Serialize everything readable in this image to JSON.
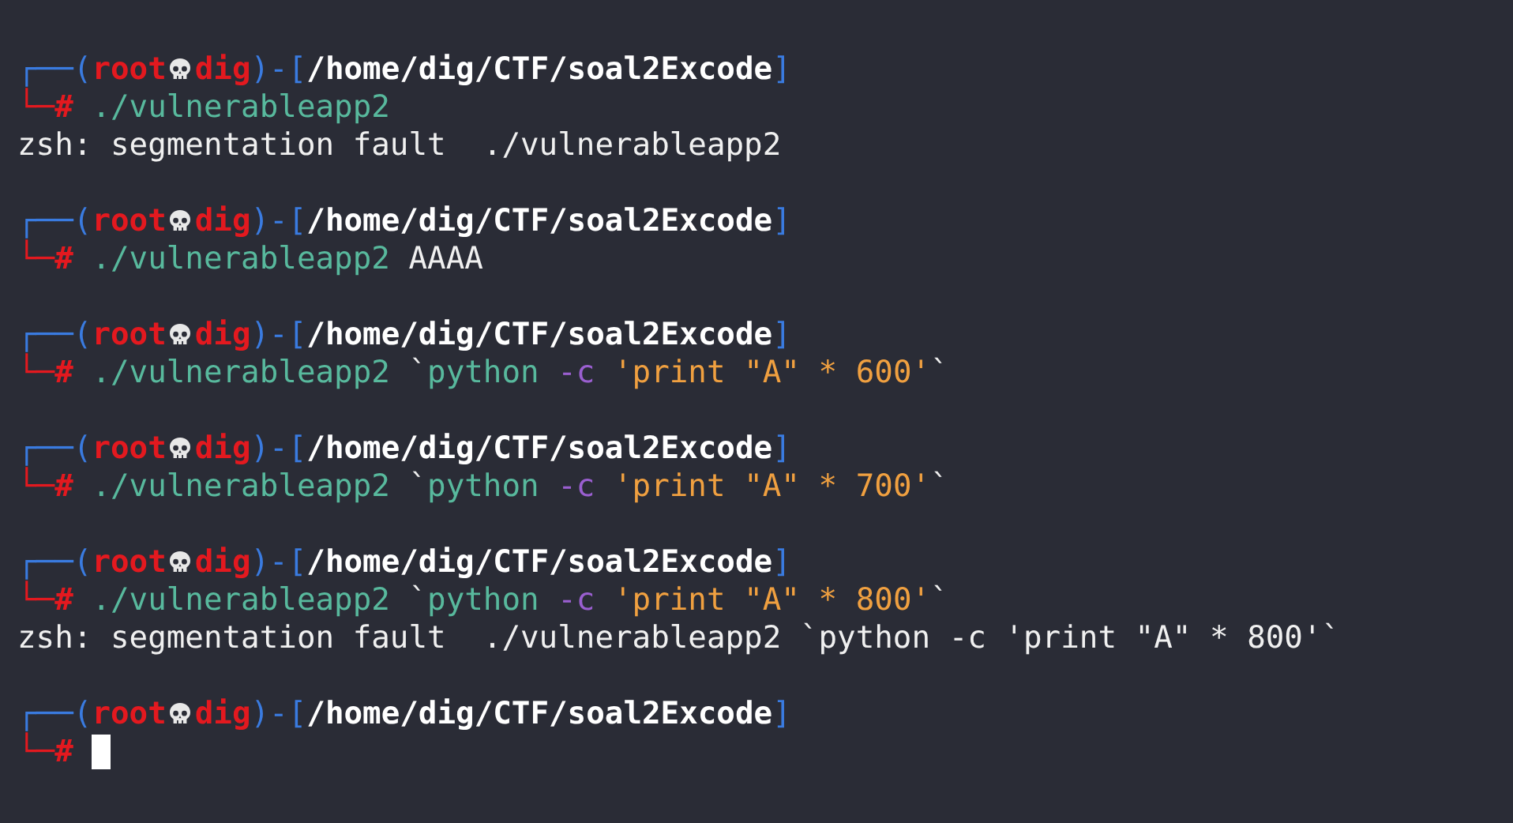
{
  "terminal": {
    "blocks": [
      {
        "prompt": {
          "frame": "┌──(",
          "user": "root",
          "host": "dig",
          "mid": ")-[",
          "path": "/home/dig/CTF/soal2Excode",
          "end": "]",
          "marker": "└─#"
        },
        "command": [
          {
            "kind": "program",
            "text": "./vulnerableapp2"
          }
        ],
        "output": [
          "zsh: segmentation fault  ./vulnerableapp2"
        ]
      },
      {
        "prompt": {
          "frame": "┌──(",
          "user": "root",
          "host": "dig",
          "mid": ")-[",
          "path": "/home/dig/CTF/soal2Excode",
          "end": "]",
          "marker": "└─#"
        },
        "command": [
          {
            "kind": "program",
            "text": "./vulnerableapp2"
          },
          {
            "kind": "plain",
            "text": " AAAA"
          }
        ]
      },
      {
        "prompt": {
          "frame": "┌──(",
          "user": "root",
          "host": "dig",
          "mid": ")-[",
          "path": "/home/dig/CTF/soal2Excode",
          "end": "]",
          "marker": "└─#"
        },
        "command": [
          {
            "kind": "program",
            "text": "./vulnerableapp2"
          },
          {
            "kind": "plain",
            "text": " `"
          },
          {
            "kind": "program",
            "text": "python"
          },
          {
            "kind": "flag",
            "text": " -c"
          },
          {
            "kind": "string",
            "text": " 'print \"A\" * 600'"
          },
          {
            "kind": "plain",
            "text": "`"
          }
        ]
      },
      {
        "prompt": {
          "frame": "┌──(",
          "user": "root",
          "host": "dig",
          "mid": ")-[",
          "path": "/home/dig/CTF/soal2Excode",
          "end": "]",
          "marker": "└─#"
        },
        "command": [
          {
            "kind": "program",
            "text": "./vulnerableapp2"
          },
          {
            "kind": "plain",
            "text": " `"
          },
          {
            "kind": "program",
            "text": "python"
          },
          {
            "kind": "flag",
            "text": " -c"
          },
          {
            "kind": "string",
            "text": " 'print \"A\" * 700'"
          },
          {
            "kind": "plain",
            "text": "`"
          }
        ]
      },
      {
        "prompt": {
          "frame": "┌──(",
          "user": "root",
          "host": "dig",
          "mid": ")-[",
          "path": "/home/dig/CTF/soal2Excode",
          "end": "]",
          "marker": "└─#"
        },
        "command": [
          {
            "kind": "program",
            "text": "./vulnerableapp2"
          },
          {
            "kind": "plain",
            "text": " `"
          },
          {
            "kind": "program",
            "text": "python"
          },
          {
            "kind": "flag",
            "text": " -c"
          },
          {
            "kind": "string",
            "text": " 'print \"A\" * 800'"
          },
          {
            "kind": "plain",
            "text": "`"
          }
        ],
        "output": [
          "zsh: segmentation fault  ./vulnerableapp2 `python -c 'print \"A\" * 800'`"
        ]
      },
      {
        "prompt": {
          "frame": "┌──(",
          "user": "root",
          "host": "dig",
          "mid": ")-[",
          "path": "/home/dig/CTF/soal2Excode",
          "end": "]",
          "marker": "└─#"
        }
      }
    ],
    "cursor_visible": true
  }
}
